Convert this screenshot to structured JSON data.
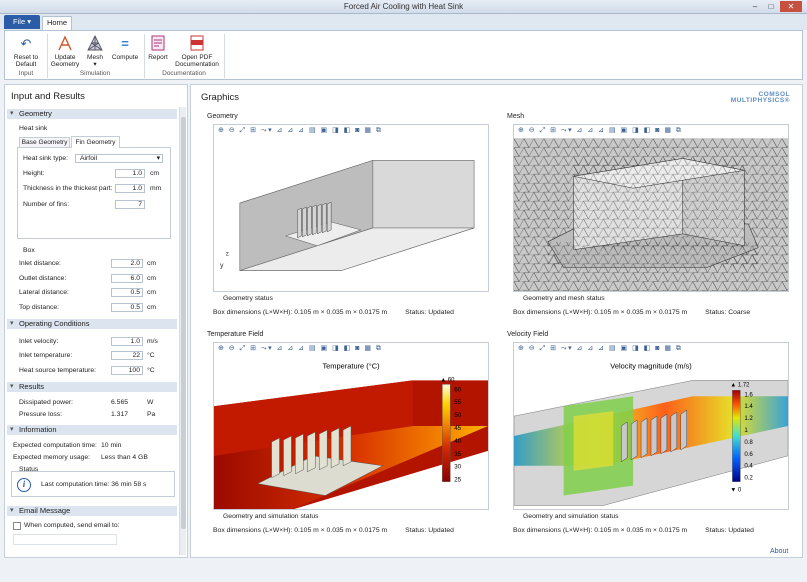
{
  "window": {
    "title": "Forced Air Cooling with Heat Sink"
  },
  "tabs": {
    "file": "File ▾",
    "home": "Home"
  },
  "ribbon": {
    "buttons": [
      {
        "label": "Reset to\nDefault",
        "icon": "reset-icon"
      },
      {
        "label": "Update\nGeometry",
        "icon": "geometry-icon"
      },
      {
        "label": "Mesh\n▾",
        "icon": "mesh-icon"
      },
      {
        "label": "Compute",
        "icon": "compute-icon"
      },
      {
        "label": "Report",
        "icon": "report-icon"
      },
      {
        "label": "Open PDF\nDocumentation",
        "icon": "pdf-icon"
      }
    ],
    "groups": [
      "Input",
      "Simulation",
      "Documentation"
    ]
  },
  "left": {
    "title": "Input and Results",
    "sections": {
      "geometry": "Geometry",
      "operating": "Operating Conditions",
      "results": "Results",
      "information": "Information",
      "email": "Email Message"
    },
    "heatsink": {
      "label": "Heat sink",
      "tab1": "Base Geometry",
      "tab2": "Fin Geometry",
      "type_label": "Heat sink type:",
      "type_value": "Airfoil",
      "height_label": "Height:",
      "height_value": "1.0",
      "height_unit": "cm",
      "thick_label": "Thickness in the thickest part:",
      "thick_value": "1.0",
      "thick_unit": "mm",
      "fins_label": "Number of fins:",
      "fins_value": "7"
    },
    "box": {
      "label": "Box",
      "inlet_label": "Inlet distance:",
      "inlet_value": "2.0",
      "inlet_unit": "cm",
      "outlet_label": "Outlet distance:",
      "outlet_value": "6.0",
      "outlet_unit": "cm",
      "lateral_label": "Lateral distance:",
      "lateral_value": "0.5",
      "lateral_unit": "cm",
      "top_label": "Top distance:",
      "top_value": "0.5",
      "top_unit": "cm"
    },
    "operating": {
      "vel_label": "Inlet velocity:",
      "vel_value": "1.0",
      "vel_unit": "m/s",
      "temp_label": "Inlet temperature:",
      "temp_value": "22",
      "temp_unit": "°C",
      "heat_label": "Heat source temperature:",
      "heat_value": "100",
      "heat_unit": "°C"
    },
    "results": {
      "power_label": "Dissipated power:",
      "power_value": "6.565",
      "power_unit": "W",
      "loss_label": "Pressure loss:",
      "loss_value": "1.317",
      "loss_unit": "Pa"
    },
    "info": {
      "time_label": "Expected computation time:",
      "time_value": "10 min",
      "mem_label": "Expected memory usage:",
      "mem_value": "Less than 4 GB",
      "status_label": "Status",
      "last_label": "Last computation time: 36 min 58 s"
    },
    "email": {
      "check_label": "When computed, send email to:"
    }
  },
  "main": {
    "title": "Graphics",
    "logo_top": "COMSOL",
    "logo_bottom": "MULTIPHYSICS®",
    "about": "About",
    "toolbar": "⊕ ⊖ ⤢ ⊞  ⤳▾  ⊿ ⊿ ⊿  ▤ ▣  ◨ ◧  ◙ ▦  ⧉",
    "panels": [
      {
        "title": "Geometry",
        "status": "Geometry status",
        "dims": "Box dimensions (L×W×H):   0.105 m  ×  0.035 m  ×  0.0175 m",
        "state": "Status:     Updated"
      },
      {
        "title": "Mesh",
        "status": "Geometry and mesh status",
        "dims": "Box dimensions (L×W×H):   0.105 m  ×  0.035 m  ×  0.0175 m",
        "state": "Status:     Coarse"
      },
      {
        "title": "Temperature Field",
        "status": "Geometry and simulation status",
        "dims": "Box dimensions (L×W×H):   0.105 m  ×  0.035 m  ×  0.0175 m",
        "state": "Status:     Updated",
        "plot": "Temperature (°C)",
        "ticks": [
          "60",
          "55",
          "50",
          "45",
          "40",
          "35",
          "30",
          "25"
        ],
        "top_label": "▲ 60"
      },
      {
        "title": "Velocity Field",
        "status": "Geometry and simulation status",
        "dims": "Box dimensions (L×W×H):   0.105 m  ×  0.035 m  ×  0.0175 m",
        "state": "Status:     Updated",
        "plot": "Velocity magnitude (m/s)",
        "ticks": [
          "1.6",
          "1.4",
          "1.2",
          "1",
          "0.8",
          "0.6",
          "0.4",
          "0.2"
        ],
        "top_label": "▲ 1.72",
        "bottom_label": "▼ 0"
      }
    ]
  },
  "colors": {
    "accent": "#2a5ca8",
    "section": "#dbe4ef"
  }
}
